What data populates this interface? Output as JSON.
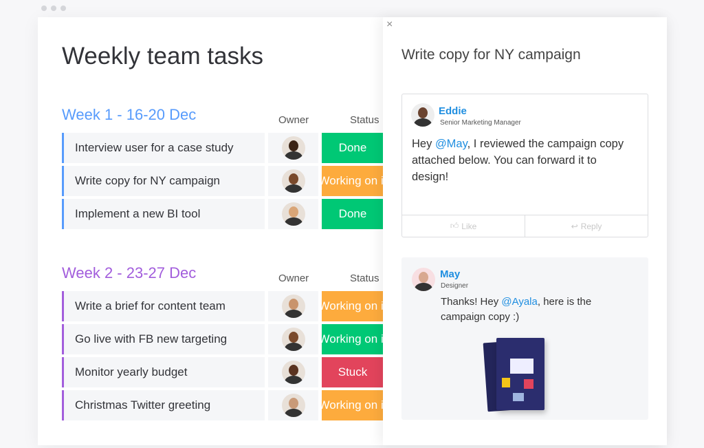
{
  "title": "Weekly team tasks",
  "colors": {
    "done": "#00c875",
    "working": "#fdab3d",
    "stuck": "#e2445c",
    "week1": "#579bfc",
    "week2": "#a25ddc",
    "mention": "#1f8ee0"
  },
  "groups": [
    {
      "title": "Week 1 - 16-20 Dec",
      "owner_label": "Owner",
      "status_label": "Status",
      "rows": [
        {
          "task": "Interview user for a case study",
          "status": "Done",
          "status_key": "done"
        },
        {
          "task": "Write copy for NY campaign",
          "status": "Working on it",
          "status_key": "working"
        },
        {
          "task": "Implement a new BI tool",
          "status": "Done",
          "status_key": "done"
        }
      ]
    },
    {
      "title": "Week 2 - 23-27 Dec",
      "owner_label": "Owner",
      "status_label": "Status",
      "rows": [
        {
          "task": "Write a brief for content team",
          "status": "Working on it",
          "status_key": "working"
        },
        {
          "task": "Go live with FB new targeting",
          "status": "Working on it",
          "status_key": "done"
        },
        {
          "task": "Monitor yearly budget",
          "status": "Stuck",
          "status_key": "stuck"
        },
        {
          "task": "Christmas Twitter greeting",
          "status": "Working on it",
          "status_key": "working"
        }
      ]
    }
  ],
  "panel": {
    "close_icon": "×",
    "title": "Write copy for NY campaign",
    "comment1": {
      "name": "Eddie",
      "role": "Senior Marketing Manager",
      "pre": "Hey ",
      "mention": "@May",
      "post": ", I reviewed the campaign copy attached below. You can forward it to design!",
      "like": "Like",
      "reply": "Reply"
    },
    "comment2": {
      "name": "May",
      "role": "Designer",
      "pre": "Thanks! Hey ",
      "mention": "@Ayala",
      "post": ", here is the campaign copy  :)"
    }
  }
}
